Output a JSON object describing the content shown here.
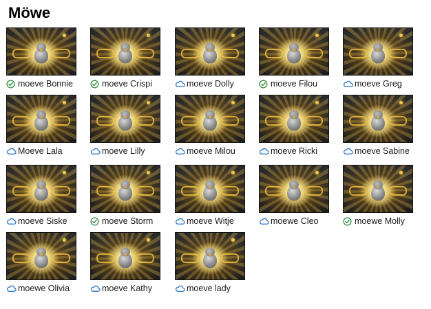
{
  "folder": {
    "title": "Möwe"
  },
  "status_colors": {
    "synced": "#2e8b3e",
    "cloud": "#1e6fc2"
  },
  "files": [
    {
      "name": "moeve Bonnie",
      "status": "synced",
      "status_icon": "check-circle-icon"
    },
    {
      "name": "moeve Crispi",
      "status": "synced",
      "status_icon": "check-circle-icon"
    },
    {
      "name": "moeve Dolly",
      "status": "cloud",
      "status_icon": "cloud-icon"
    },
    {
      "name": "moeve Filou",
      "status": "synced",
      "status_icon": "check-circle-icon"
    },
    {
      "name": "moeve Greg",
      "status": "cloud",
      "status_icon": "cloud-icon"
    },
    {
      "name": "Moeve Lala",
      "status": "cloud",
      "status_icon": "cloud-icon"
    },
    {
      "name": "moeve Lilly",
      "status": "cloud",
      "status_icon": "cloud-icon"
    },
    {
      "name": "moeve Milou",
      "status": "cloud",
      "status_icon": "cloud-icon"
    },
    {
      "name": "moeve Ricki",
      "status": "cloud",
      "status_icon": "cloud-icon"
    },
    {
      "name": "moeve Sabine",
      "status": "cloud",
      "status_icon": "cloud-icon"
    },
    {
      "name": "moeve Siske",
      "status": "cloud",
      "status_icon": "cloud-icon"
    },
    {
      "name": "moeve Storm",
      "status": "synced",
      "status_icon": "check-circle-icon"
    },
    {
      "name": "moeve Witje",
      "status": "cloud",
      "status_icon": "cloud-icon"
    },
    {
      "name": "moewe Cleo",
      "status": "cloud",
      "status_icon": "cloud-icon"
    },
    {
      "name": "moewe Molly",
      "status": "synced",
      "status_icon": "check-circle-icon"
    },
    {
      "name": "moewe Olivia",
      "status": "cloud",
      "status_icon": "cloud-icon"
    },
    {
      "name": "moeve Kathy",
      "status": "cloud",
      "status_icon": "cloud-icon"
    },
    {
      "name": "moeve lady",
      "status": "cloud",
      "status_icon": "cloud-icon"
    }
  ]
}
